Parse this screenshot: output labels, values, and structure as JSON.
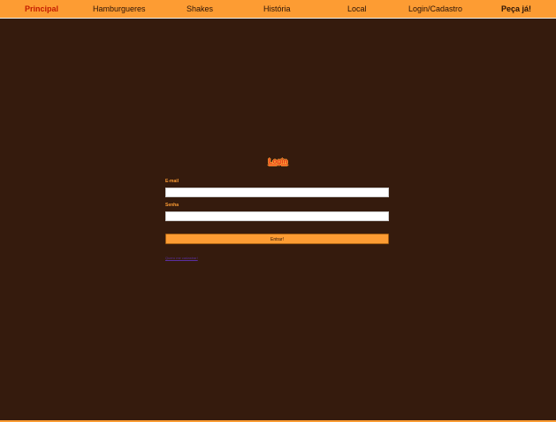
{
  "nav": {
    "principal": "Principal",
    "hamburgueres": "Hamburgueres",
    "shakes": "Shakes",
    "historia": "História",
    "local": "Local",
    "login_cadastro": "Login/Cadastro",
    "peca_ja": "Peça já!"
  },
  "login": {
    "title": "Login",
    "email_label": "E-mail",
    "email_value": "",
    "password_label": "Senha",
    "password_value": "",
    "submit_label": "Entrar!",
    "signup_link": "Quero me cadastrar!"
  },
  "colors": {
    "background": "#351b0d",
    "accent": "#fd9c33",
    "active_nav": "#c41d00",
    "title": "#e6381b",
    "link": "#5a2fa0"
  }
}
